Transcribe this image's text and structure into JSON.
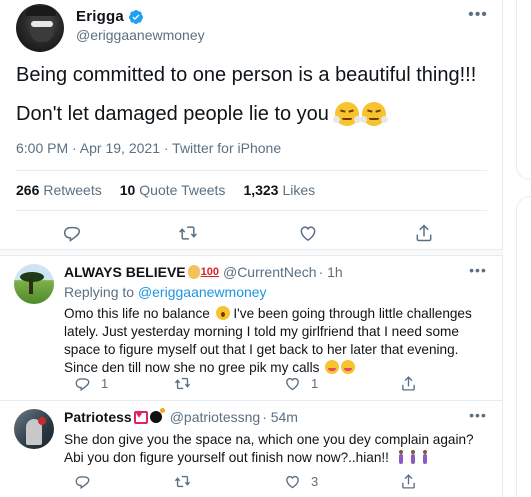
{
  "main_tweet": {
    "author_name": "Erigga",
    "author_handle": "@eriggaanewmoney",
    "line1": "Being committed to one person is a beautiful thing!!!",
    "line2": "Don't let damaged people lie to you",
    "meta": "6:00 PM · Apr 19, 2021 · Twitter for iPhone",
    "stats": {
      "retweets_count": "266",
      "retweets_label": "Retweets",
      "quotes_count": "10",
      "quotes_label": "Quote Tweets",
      "likes_count": "1,323",
      "likes_label": "Likes"
    },
    "icons": [
      "verified-icon",
      "reply-icon",
      "retweet-icon",
      "like-icon",
      "share-icon",
      "more-icon",
      "face-with-steam-emoji"
    ]
  },
  "replies": [
    {
      "name": "ALWAYS BELIEVE",
      "handle": "@CurrentNech",
      "time": "· 1h",
      "replying_prefix": "Replying to",
      "replying_handle": "@eriggaanewmoney",
      "text_part1": "Omo this life no balance",
      "text_part2": " I've been going through little challenges lately.  Just yesterday morning I told my girlfriend that I need some space to figure myself out that I get back to her later that evening. Since den till now she no gree pik my calls",
      "reply_count": "1",
      "retweet_count": "",
      "like_count": "1",
      "name_emojis": [
        "ok-hand-emoji",
        "hundred-points-emoji"
      ]
    },
    {
      "name": "Patriotess",
      "handle": "@patriotessng",
      "time": "· 54m",
      "text": "She don give you the space na, which one you dey complain again? Abi you don figure yourself out finish now now?..hian!!",
      "reply_count": "",
      "retweet_count": "",
      "like_count": "3",
      "name_emojis": [
        "heart-box-emoji",
        "bomb-emoji"
      ]
    }
  ],
  "colors": {
    "accent": "#1b95e0",
    "verified": "#1da1f2",
    "secondary_text": "#5b7083",
    "border": "#e6ecf0",
    "gap_band": "#f7f9fa"
  }
}
